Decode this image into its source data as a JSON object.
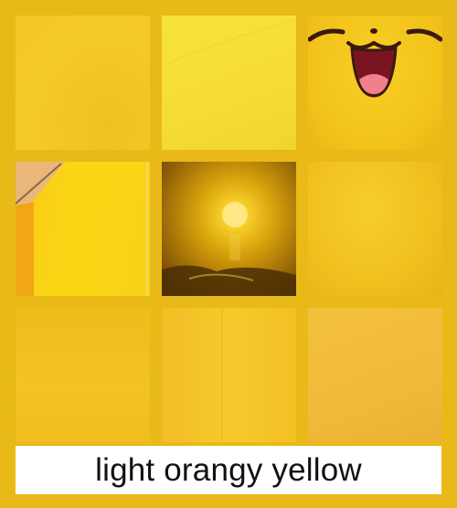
{
  "caption": "light orangy yellow",
  "colors": {
    "frame": "#e9b918",
    "caption_background": "#ffffff",
    "caption_text": "#111111"
  },
  "tiles": [
    {
      "name": "yellow-wall"
    },
    {
      "name": "pale-yellow-surface"
    },
    {
      "name": "smiling-cartoon-face"
    },
    {
      "name": "yellow-wall-with-roof-edge"
    },
    {
      "name": "golden-sunset-over-water"
    },
    {
      "name": "yellow-gradient"
    },
    {
      "name": "yellow-textured-surface"
    },
    {
      "name": "yellow-paper"
    },
    {
      "name": "light-orange-surface"
    }
  ]
}
